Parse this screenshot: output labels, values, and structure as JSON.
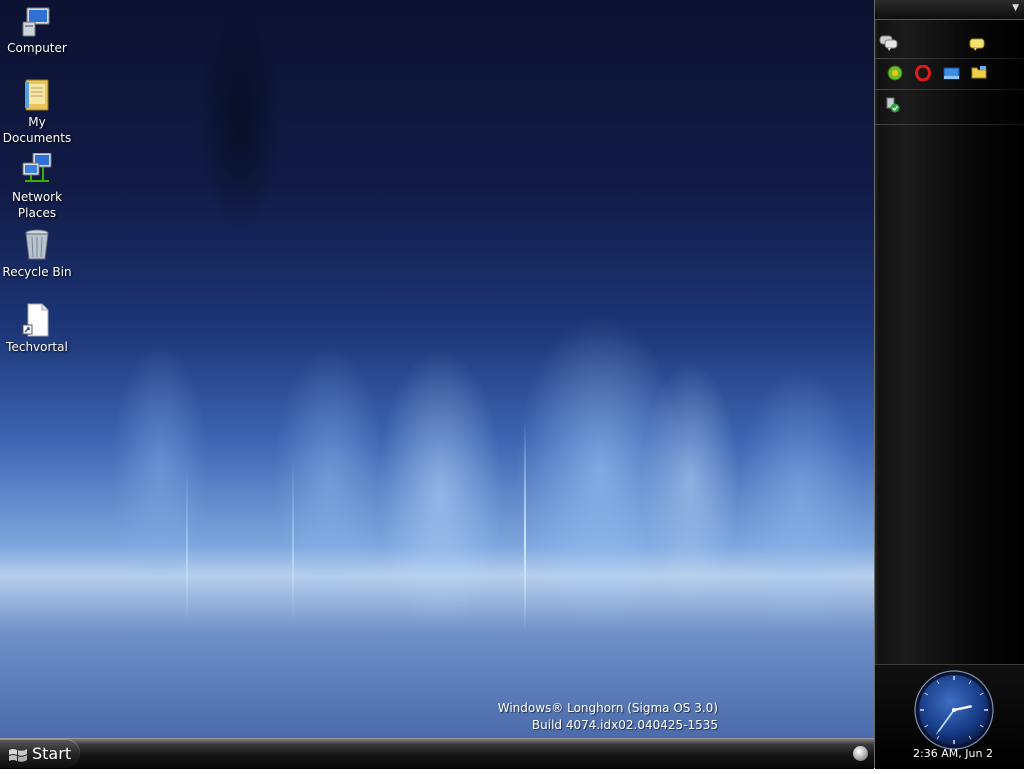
{
  "desktop": {
    "icons": [
      {
        "label": "Computer"
      },
      {
        "label": "My Documents"
      },
      {
        "label": "Network Places"
      },
      {
        "label": "Recycle Bin"
      },
      {
        "label": "Techvortal"
      }
    ],
    "watermark": {
      "line1": "Windows® Longhorn (Sigma OS 3.0)",
      "line2": "Build 4074.idx02.040425-1535"
    }
  },
  "taskbar": {
    "start_label": "Start"
  },
  "sidebar": {
    "menu_arrow": "▼",
    "tiles": {
      "messenger_icons": [
        "contacts-chat-icon",
        "message-bubble-icon"
      ],
      "quick_launch_icons": [
        "browser-globe-icon",
        "opera-icon",
        "show-desktop-icon",
        "explorer-folder-icon"
      ],
      "tray_icons": [
        "security-check-icon"
      ]
    },
    "clock": {
      "display": "2:36 AM, Jun 2",
      "time": "2:36",
      "seconds": 36
    }
  },
  "colors": {
    "accent_blue": "#3e66b3",
    "sidebar_bg": "#000000",
    "text": "#ffffff"
  }
}
